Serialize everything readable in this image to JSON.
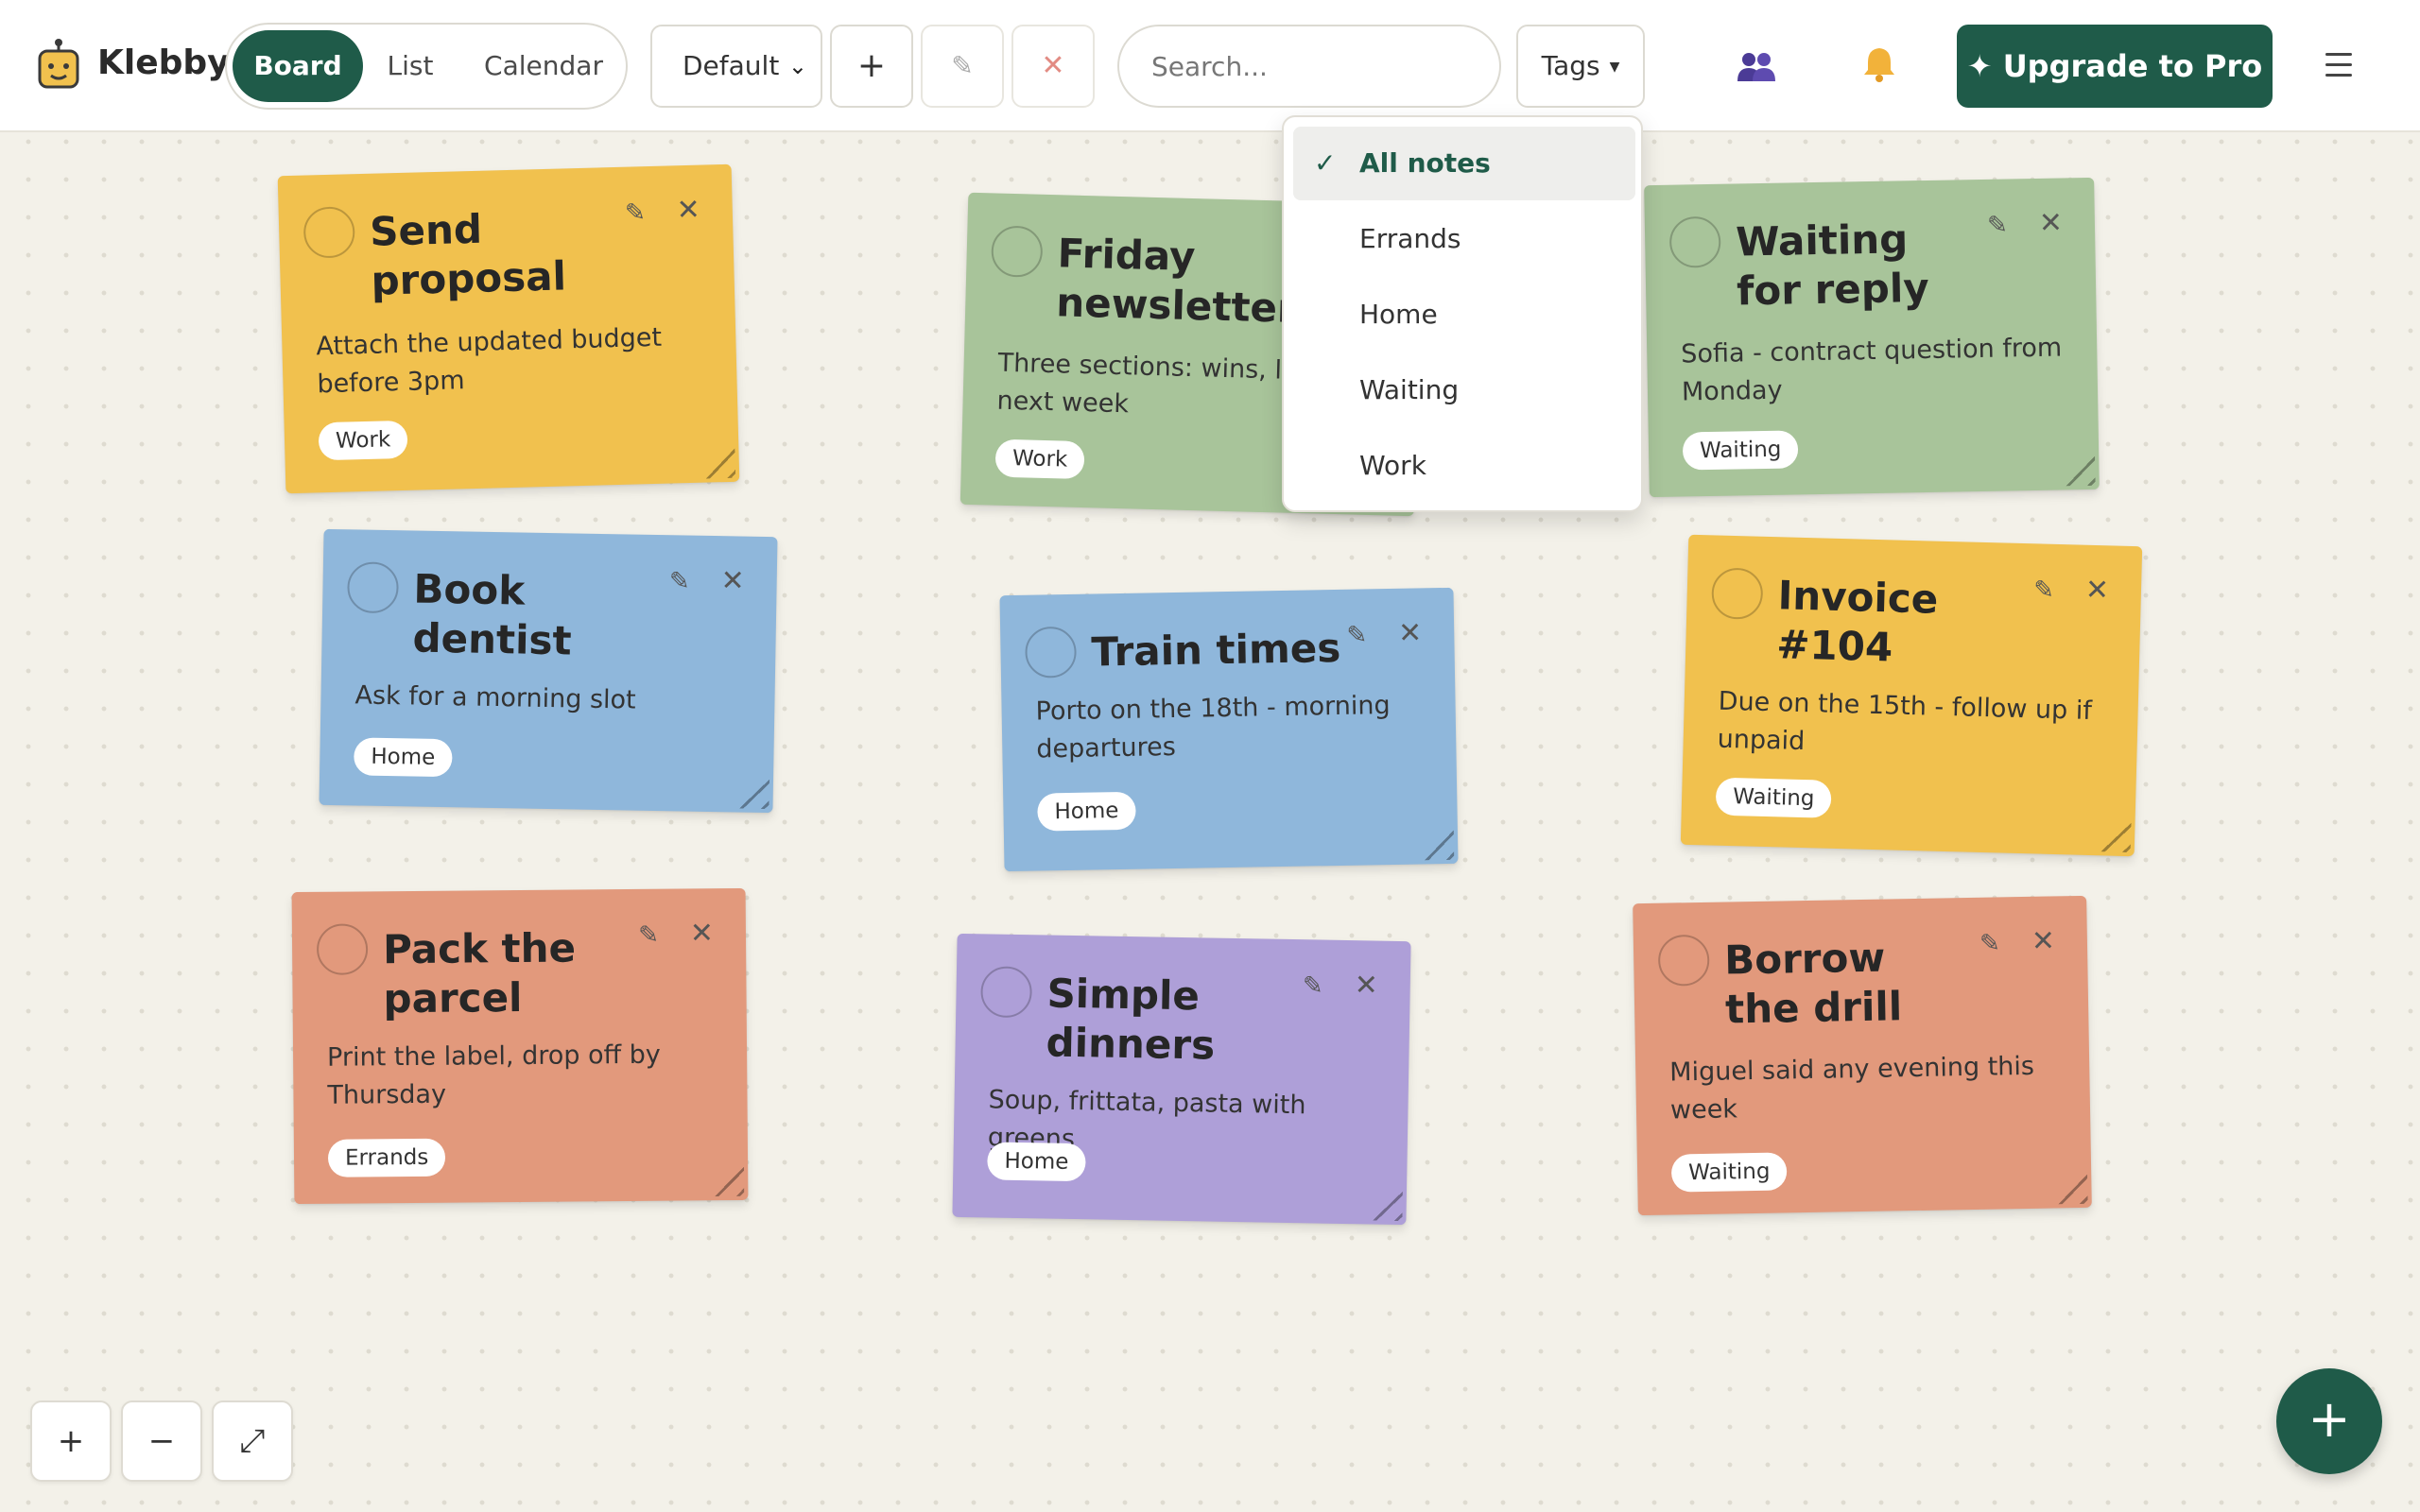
{
  "app": {
    "brand": "Klebby",
    "logo_icon": "robot-face-icon"
  },
  "views": [
    {
      "label": "Board",
      "active": true
    },
    {
      "label": "List",
      "active": false
    },
    {
      "label": "Calendar",
      "active": false
    }
  ],
  "toolbar": {
    "board_select_value": "Default",
    "add_label": "+",
    "edit_icon": "pencil-icon",
    "delete_icon": "close-icon",
    "search_placeholder": "Search...",
    "tags_label": "Tags",
    "upgrade_label": "✦ Upgrade to Pro",
    "accent_color": "#1f5b49"
  },
  "tags_menu": {
    "items": [
      {
        "label": "All notes",
        "selected": true
      },
      {
        "label": "Errands",
        "selected": false
      },
      {
        "label": "Home",
        "selected": false
      },
      {
        "label": "Waiting",
        "selected": false
      },
      {
        "label": "Work",
        "selected": false
      }
    ],
    "check_mark": "✓"
  },
  "notes": [
    {
      "title": "Send proposal",
      "body": "Attach the updated budget before 3pm",
      "tag": "Work",
      "color": "#f1c14e"
    },
    {
      "title": "Friday newsletter",
      "body": "Three sections: wins, lessons, next week",
      "tag": "Work",
      "color": "#a8c49a"
    },
    {
      "title": "Waiting for reply",
      "body": "Sofia - contract question from Monday",
      "tag": "Waiting",
      "color": "#a8c49a"
    },
    {
      "title": "Book dentist",
      "body": "Ask for a morning slot",
      "tag": "Home",
      "color": "#8fb7db"
    },
    {
      "title": "Train times",
      "body": "Porto on the 18th - morning departures",
      "tag": "Home",
      "color": "#8fb7db"
    },
    {
      "title": "Invoice #104",
      "body": "Due on the 15th - follow up if unpaid",
      "tag": "Waiting",
      "color": "#f1c14e"
    },
    {
      "title": "Pack the parcel",
      "body": "Print the label, drop off by Thursday",
      "tag": "Errands",
      "color": "#e2997c"
    },
    {
      "title": "Simple dinners",
      "body": "Soup, frittata, pasta with greens",
      "tag": "Home",
      "color": "#ae9fd8"
    },
    {
      "title": "Borrow the drill",
      "body": "Miguel said any evening this week",
      "tag": "Waiting",
      "color": "#e2997c"
    }
  ],
  "zoom": {
    "in_label": "+",
    "out_label": "−",
    "fit_label": "⤢"
  },
  "fab_label": "+"
}
